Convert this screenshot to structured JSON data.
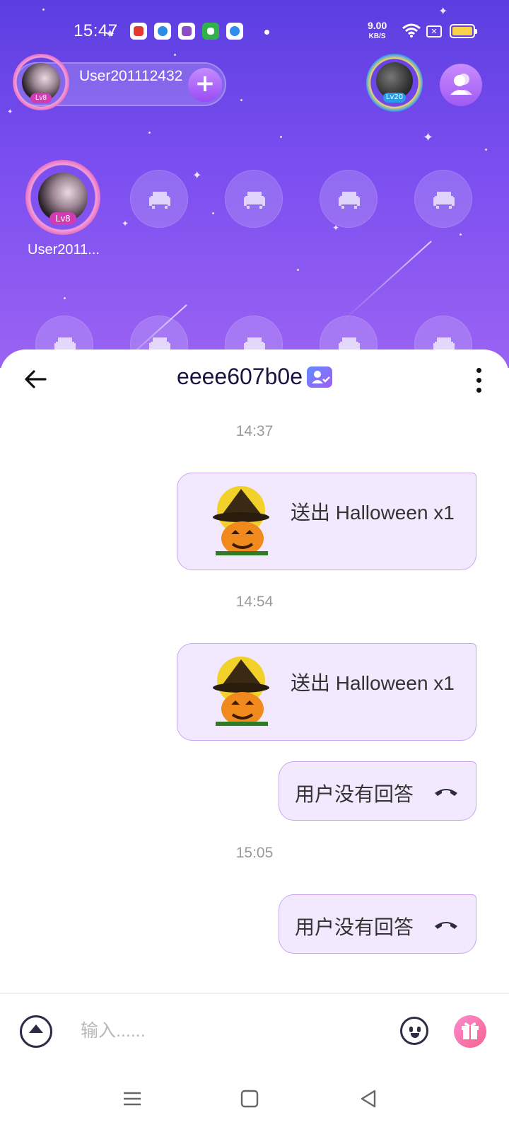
{
  "status_bar": {
    "time": "15:47",
    "net_speed_value": "9.00",
    "net_speed_unit": "KB/S",
    "sim_icon_text": "✕"
  },
  "room": {
    "owner_name": "User201112432",
    "owner_level": "Lv8",
    "host_level": "Lv20",
    "seated_user_name": "User2011...",
    "seated_user_level": "Lv8",
    "colors": {
      "gradient_top": "#5b3ee0",
      "gradient_bottom": "#9a63f2"
    }
  },
  "chat": {
    "title": "eeee607b0e",
    "messages": [
      {
        "type": "timestamp",
        "text": "14:37"
      },
      {
        "type": "gift",
        "text": "送出 Halloween x1",
        "icon": "halloween-pumpkin-gift-icon"
      },
      {
        "type": "timestamp",
        "text": "14:54"
      },
      {
        "type": "gift",
        "text": "送出 Halloween x1",
        "icon": "halloween-pumpkin-gift-icon"
      },
      {
        "type": "call",
        "text": "用户没有回答",
        "icon": "hangup-phone-icon"
      },
      {
        "type": "timestamp",
        "text": "15:05"
      },
      {
        "type": "call",
        "text": "用户没有回答",
        "icon": "hangup-phone-icon"
      }
    ],
    "colors": {
      "bubble_bg": "#f2e9ff",
      "bubble_border": "#c9a6f2"
    }
  },
  "input": {
    "placeholder": "输入......",
    "value": ""
  }
}
